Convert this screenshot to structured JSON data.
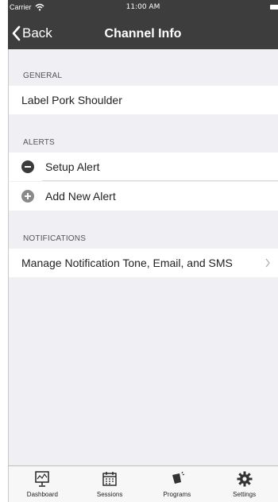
{
  "status_bar": {
    "carrier": "Carrier",
    "time": "11:00 AM"
  },
  "nav": {
    "back_label": "Back",
    "title": "Channel Info"
  },
  "sections": {
    "general": {
      "header": "GENERAL",
      "label_row": "Label  Pork Shoulder"
    },
    "alerts": {
      "header": "ALERTS",
      "items": [
        "Setup Alert",
        "Add New Alert"
      ]
    },
    "notifications": {
      "header": "NOTIFICATIONS",
      "manage_row": "Manage Notification Tone, Email, and SMS"
    }
  },
  "tabbar": {
    "items": [
      {
        "label": "Dashboard",
        "icon": "dashboard-icon"
      },
      {
        "label": "Sessions",
        "icon": "calendar-icon"
      },
      {
        "label": "Programs",
        "icon": "programs-icon"
      },
      {
        "label": "Settings",
        "icon": "gear-icon"
      }
    ]
  }
}
